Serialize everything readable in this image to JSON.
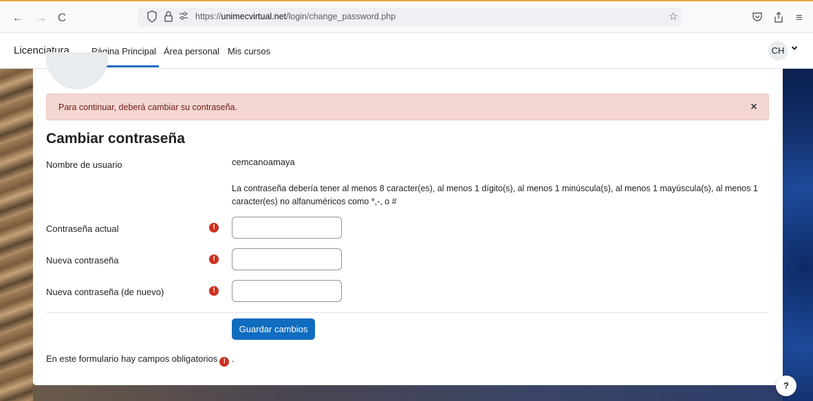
{
  "browser": {
    "back_glyph": "←",
    "forward_glyph": "→",
    "reload_glyph": "C",
    "url_prefix": "https://",
    "url_domain": "unimecvirtual.net",
    "url_path": "/login/change_password.php",
    "icons": [
      "back-icon",
      "forward-icon",
      "reload-icon",
      "shield-icon",
      "lock-icon",
      "permissions-icon",
      "star-icon",
      "pocket-icon",
      "share-icon",
      "menu-icon"
    ]
  },
  "navbar": {
    "brand": "Licenciatura",
    "links": [
      {
        "label": "Página Principal",
        "active": true
      },
      {
        "label": "Área personal",
        "active": false
      },
      {
        "label": "Mis cursos",
        "active": false
      }
    ],
    "avatar_initials": "CH"
  },
  "alert": {
    "message": "Para continuar, deberá cambiar su contraseña.",
    "close_glyph": "×"
  },
  "form": {
    "title": "Cambiar contraseña",
    "username_label": "Nombre de usuario",
    "username_value": "cemcanoamaya",
    "policy_text": "La contraseña debería tener al menos 8 caracter(es), al menos 1 dígito(s), al menos 1 minúscula(s), al menos 1 mayúscula(s), al menos 1 caracter(es) no alfanuméricos como *,-, o #",
    "fields": [
      {
        "label": "Contraseña actual",
        "value": "",
        "required": true
      },
      {
        "label": "Nueva contraseña",
        "value": "",
        "required": true
      },
      {
        "label": "Nueva contraseña (de nuevo)",
        "value": "",
        "required": true
      }
    ],
    "required_glyph": "!",
    "submit_label": "Guardar cambios",
    "required_note": "En este formulario hay campos obligatorios",
    "required_note_suffix": " ."
  },
  "help": {
    "glyph": "?"
  },
  "colors": {
    "accent": "#0f6cbf",
    "alert_bg": "#f4d6d2",
    "alert_text": "#6e211a",
    "required": "#ca3120"
  }
}
